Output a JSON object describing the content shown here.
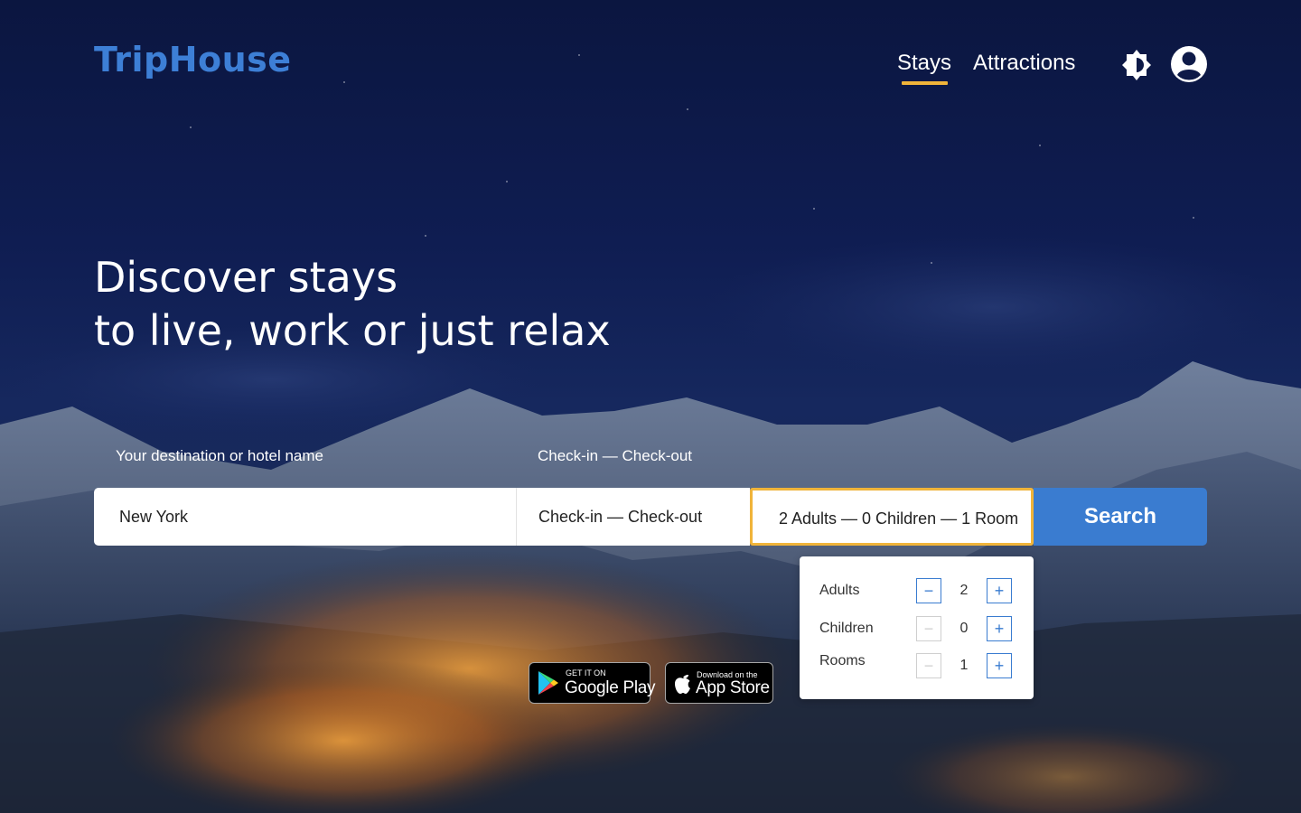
{
  "brand": {
    "name": "TripHouse",
    "color": "#3d7fd6"
  },
  "nav": {
    "items": [
      {
        "label": "Stays",
        "active": true
      },
      {
        "label": "Attractions",
        "active": false
      }
    ],
    "theme_toggle_icon": "brightness-icon",
    "user_icon": "account-circle-icon"
  },
  "hero": {
    "line1": "Discover stays",
    "line2": "to live, work or just relax"
  },
  "search": {
    "destination_label": "Your destination or hotel name",
    "destination_value": "New York",
    "dates_label": "Check-in — Check-out",
    "dates_placeholder": "Check-in — Check-out",
    "guests_value": "2 Adults — 0 Children — 1 Room",
    "search_button": "Search",
    "accent_color": "#f0b43a",
    "button_color": "#3a7cd0"
  },
  "guests_panel": {
    "rows": [
      {
        "label": "Adults",
        "value": "2"
      },
      {
        "label": "Children",
        "value": "0"
      },
      {
        "label": "Rooms",
        "value": "1"
      }
    ],
    "minus": "−",
    "plus": "+"
  },
  "stores": {
    "google": {
      "small": "GET IT ON",
      "big": "Google Play"
    },
    "apple": {
      "small": "Download on the",
      "big": "App Store"
    }
  }
}
